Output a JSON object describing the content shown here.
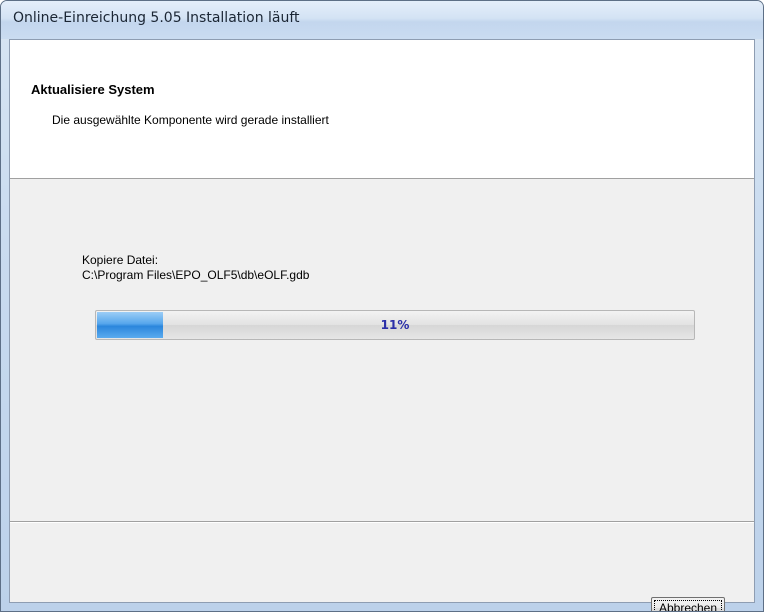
{
  "window": {
    "title": "Online-Einreichung 5.05 Installation läuft"
  },
  "header": {
    "title": "Aktualisiere System",
    "subtitle": "Die ausgewählte Komponente wird gerade installiert"
  },
  "status": {
    "label": "Kopiere Datei:",
    "path": "C:\\Program Files\\EPO_OLF5\\db\\eOLF.gdb"
  },
  "progress": {
    "percent": 11,
    "label": "11%"
  },
  "buttons": {
    "cancel": "Abbrechen"
  }
}
